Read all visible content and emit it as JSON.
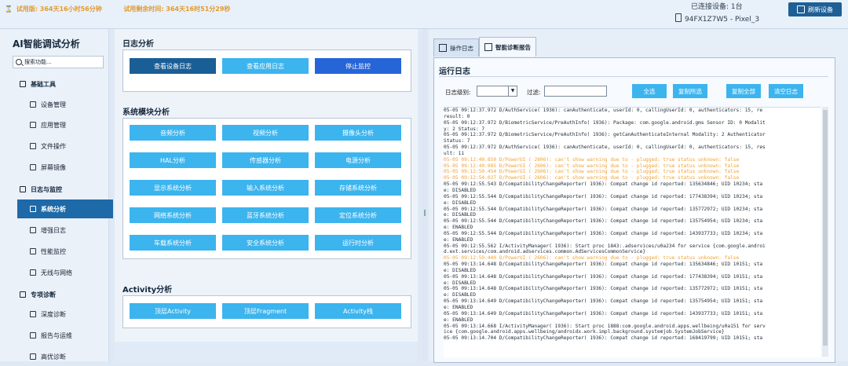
{
  "topbar": {
    "trial_label": "试用版: 364天16小时56分钟",
    "remaining_label": "试用剩余时间: 364天16时51分29秒",
    "connected_label": "已连接设备: 1台",
    "device_name": "94FX1Z7W5 - Pixel_3",
    "refresh_label": "刷新设备"
  },
  "sidebar": {
    "title": "AI智能调试分析",
    "search_placeholder": "搜索功能...",
    "groups": [
      {
        "label": "基础工具",
        "icon": "wrench-icon"
      },
      {
        "label": "日志与监控",
        "icon": "chart-icon"
      },
      {
        "label": "专项诊断",
        "icon": "stethoscope-icon"
      }
    ],
    "items": [
      {
        "label": "设备管理",
        "icon": "phone-icon"
      },
      {
        "label": "应用管理",
        "icon": "app-icon"
      },
      {
        "label": "文件操作",
        "icon": "folder-icon"
      },
      {
        "label": "屏幕镜像",
        "icon": "screen-icon"
      },
      {
        "label": "系统分析",
        "icon": "pen-icon"
      },
      {
        "label": "增强日志",
        "icon": "search-icon"
      },
      {
        "label": "性能监控",
        "icon": "monitor-icon"
      },
      {
        "label": "无线与网络",
        "icon": "network-icon"
      },
      {
        "label": "深度诊断",
        "icon": "magnifier-icon"
      },
      {
        "label": "报告与运维",
        "icon": "report-icon"
      },
      {
        "label": "高优诊断",
        "icon": "priority-icon"
      }
    ]
  },
  "log_analysis": {
    "title": "日志分析",
    "buttons": [
      "查看设备日志",
      "查看应用日志",
      "停止监控"
    ]
  },
  "system_modules": {
    "title": "系统模块分析",
    "buttons": [
      "音频分析",
      "视频分析",
      "摄像头分析",
      "HAL分析",
      "传感器分析",
      "电源分析",
      "显示系统分析",
      "输入系统分析",
      "存储系统分析",
      "网络系统分析",
      "蓝牙系统分析",
      "定位系统分析",
      "车载系统分析",
      "安全系统分析",
      "运行时分析"
    ]
  },
  "activity": {
    "title": "Activity分析",
    "buttons": [
      "顶层Activity",
      "顶层Fragment",
      "Activity栈"
    ]
  },
  "right_panel": {
    "tabs": [
      "操作日志",
      "智能诊断报告"
    ],
    "title": "运行日志",
    "level_label": "日志级别:",
    "filter_label": "过滤:",
    "buttons": [
      "全选",
      "复制所选",
      "复制全部",
      "清空日志"
    ],
    "log_lines": [
      {
        "t": "05-05 09:12:37.972 D/AuthService( 1936): canAuthenticate, userId: 0, callingUserId: 0, authenticators: 15, re",
        "w": false
      },
      {
        "t": "result: 0",
        "w": false
      },
      {
        "t": "05-05 09:12:37.972 D/BiometricService/PreAuthInfo( 1936): Package: com.google.android.gms Sensor ID: 0 Modalit",
        "w": false
      },
      {
        "t": "y: 2 Status: 7",
        "w": false
      },
      {
        "t": "05-05 09:12:37.972 D/BiometricService/PreAuthInfo( 1936): getCanAuthenticateInternal Modality: 2 Authenticator",
        "w": false
      },
      {
        "t": "Status: 7",
        "w": false
      },
      {
        "t": "05-05 09:12:37.972 D/AuthService( 1936): canAuthenticate, userId: 0, callingUserId: 0, authenticators: 15, res",
        "w": false
      },
      {
        "t": "ult: 11",
        "w": false
      },
      {
        "t": "05-05 09:12:40.850 D/PowerUI ( 2606): can't show warning due to - plugged: true status unknown: false",
        "w": true
      },
      {
        "t": "05-05 09:12:49.985 D/PowerUI ( 2606): can't show warning due to - plugged: true status unknown: false",
        "w": true
      },
      {
        "t": "05-05 09:12:50.454 D/PowerUI ( 2606): can't show warning due to - plugged: true status unknown: false",
        "w": true
      },
      {
        "t": "05-05 09:12:54.027 D/PowerUI ( 2606): can't show warning due to - plugged: true status unknown: false",
        "w": true
      },
      {
        "t": "05-05 09:12:55.543 D/CompatibilityChangeReporter( 1936): Compat change id reported: 135634846; UID 10234; sta",
        "w": false
      },
      {
        "t": "e: DISABLED",
        "w": false
      },
      {
        "t": "05-05 09:12:55.544 D/CompatibilityChangeReporter( 1936): Compat change id reported: 177438394; UID 10234; sta",
        "w": false
      },
      {
        "t": "e: DISABLED",
        "w": false
      },
      {
        "t": "05-05 09:12:55.544 D/CompatibilityChangeReporter( 1936): Compat change id reported: 135772972; UID 10234; sta",
        "w": false
      },
      {
        "t": "e: DISABLED",
        "w": false
      },
      {
        "t": "05-05 09:12:55.544 D/CompatibilityChangeReporter( 1936): Compat change id reported: 135754954; UID 10234; sta",
        "w": false
      },
      {
        "t": "e: ENABLED",
        "w": false
      },
      {
        "t": "05-05 09:12:55.544 D/CompatibilityChangeReporter( 1936): Compat change id reported: 143937733; UID 10234; sta",
        "w": false
      },
      {
        "t": "e: ENABLED",
        "w": false
      },
      {
        "t": "05-05 09:12:55.562 I/ActivityManager( 1936): Start proc 1843:.adservices/u0a234 for service {com.google.androi",
        "w": false
      },
      {
        "t": "d.ext.services/com.android.adservices.common.AdServicesCommonService}",
        "w": false
      },
      {
        "t": "05-05 09:12:59.440 D/PowerUI ( 2606): can't show warning due to - plugged: true status unknown: false",
        "w": true
      },
      {
        "t": "05-05 09:13:14.648 D/CompatibilityChangeReporter( 1936): Compat change id reported: 135634846; UID 10151; sta",
        "w": false
      },
      {
        "t": "e: DISABLED",
        "w": false
      },
      {
        "t": "05-05 09:13:14.648 D/CompatibilityChangeReporter( 1936): Compat change id reported: 177438394; UID 10151; sta",
        "w": false
      },
      {
        "t": "e: DISABLED",
        "w": false
      },
      {
        "t": "05-05 09:13:14.648 D/CompatibilityChangeReporter( 1936): Compat change id reported: 135772972; UID 10151; sta",
        "w": false
      },
      {
        "t": "e: DISABLED",
        "w": false
      },
      {
        "t": "05-05 09:13:14.649 D/CompatibilityChangeReporter( 1936): Compat change id reported: 135754954; UID 10151; sta",
        "w": false
      },
      {
        "t": "e: ENABLED",
        "w": false
      },
      {
        "t": "05-05 09:13:14.649 D/CompatibilityChangeReporter( 1936): Compat change id reported: 143937733; UID 10151; sta",
        "w": false
      },
      {
        "t": "e: ENABLED",
        "w": false
      },
      {
        "t": "05-05 09:13:14.668 I/ActivityManager( 1936): Start proc 1888:com.google.android.apps.wellbeing/u0a151 for serv",
        "w": false
      },
      {
        "t": "ice {com.google.android.apps.wellbeing/androidx.work.impl.background.systemjob.SystemJobService}",
        "w": false
      },
      {
        "t": "05-05 09:13:14.704 D/CompatibilityChangeReporter( 1936): Compat change id reported: 168419799; UID 10151; sta",
        "w": false
      }
    ]
  },
  "colors": {
    "accent": "#3cb4ee",
    "dark_button": "#1a5e96",
    "stop_button": "#2565d8",
    "active_nav": "#1e6aa8",
    "warning_text": "#f2a234"
  }
}
